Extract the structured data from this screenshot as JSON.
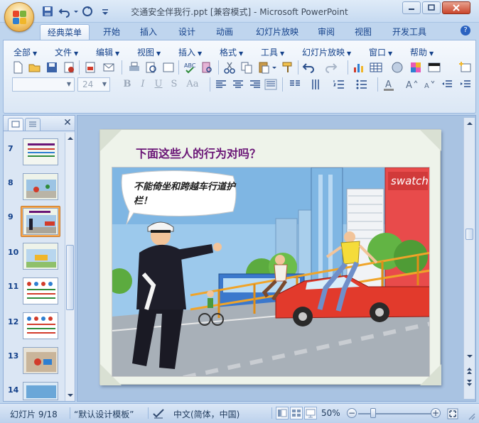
{
  "window": {
    "title": "交通安全伴我行.ppt [兼容模式] - Microsoft PowerPoint"
  },
  "ribbon_tabs": [
    "经典菜单",
    "开始",
    "插入",
    "设计",
    "动画",
    "幻灯片放映",
    "审阅",
    "视图",
    "开发工具"
  ],
  "classic_menu": [
    "全部",
    "文件",
    "编辑",
    "视图",
    "插入",
    "格式",
    "工具",
    "幻灯片放映",
    "窗口",
    "帮助"
  ],
  "format_bar": {
    "font_name": "",
    "font_size": "24"
  },
  "slides_panel": {
    "numbers": [
      "7",
      "8",
      "9",
      "10",
      "11",
      "12",
      "13",
      "14"
    ],
    "selected": "9"
  },
  "slide": {
    "title": "下面这些人的行为对吗？",
    "bubble_text": "不能倚坐和跨越车行道护栏！",
    "billboard": "swatch"
  },
  "status": {
    "slide_info": "幻灯片 9/18",
    "template": "“默认设计模板”",
    "language": "中文(简体，中国)",
    "zoom": "50%",
    "zoom_fraction": 0.5
  },
  "icons": [
    "office-button",
    "save-icon",
    "undo-icon",
    "redo-icon",
    "help-icon"
  ],
  "colors": {
    "title_purple": "#6a1576",
    "ribbon_blue": "#15428b",
    "selected_thumb": "#f6a84f"
  }
}
